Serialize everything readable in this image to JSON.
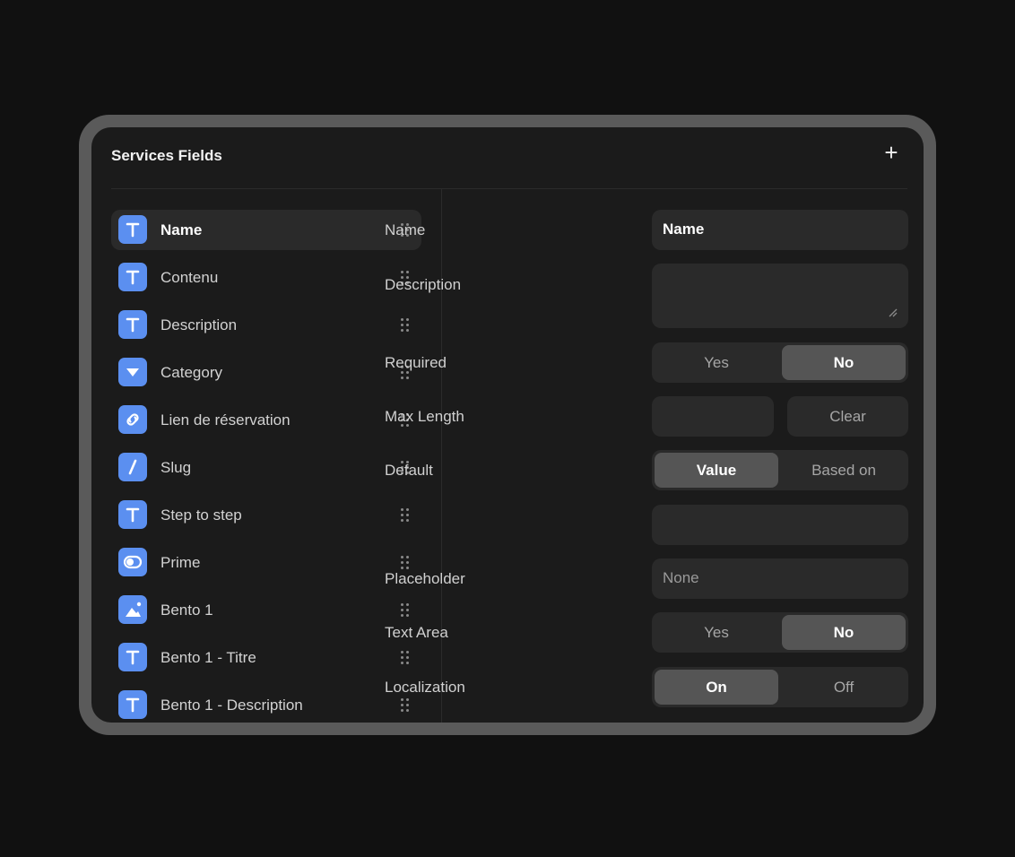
{
  "panel": {
    "title": "Services Fields",
    "add_label": "+"
  },
  "fields": [
    {
      "label": "Name",
      "icon": "text-icon",
      "selected": true
    },
    {
      "label": "Contenu",
      "icon": "text-icon"
    },
    {
      "label": "Description",
      "icon": "text-icon"
    },
    {
      "label": "Category",
      "icon": "dropdown-icon"
    },
    {
      "label": "Lien de réservation",
      "icon": "link-icon"
    },
    {
      "label": "Slug",
      "icon": "slash-icon"
    },
    {
      "label": "Step to step",
      "icon": "text-icon"
    },
    {
      "label": "Prime",
      "icon": "toggle-icon"
    },
    {
      "label": "Bento 1",
      "icon": "image-icon"
    },
    {
      "label": "Bento 1 - Titre",
      "icon": "text-icon"
    },
    {
      "label": "Bento 1 - Description",
      "icon": "text-icon"
    }
  ],
  "properties": {
    "name": {
      "label": "Name",
      "value": "Name"
    },
    "description": {
      "label": "Description",
      "value": ""
    },
    "required": {
      "label": "Required",
      "options": [
        "Yes",
        "No"
      ],
      "selected": "No"
    },
    "max_length": {
      "label": "Max Length",
      "value": "",
      "clear_label": "Clear"
    },
    "default": {
      "label": "Default",
      "options": [
        "Value",
        "Based on"
      ],
      "selected": "Value",
      "value": ""
    },
    "placeholder": {
      "label": "Placeholder",
      "value": "None"
    },
    "text_area": {
      "label": "Text Area",
      "options": [
        "Yes",
        "No"
      ],
      "selected": "No"
    },
    "localization": {
      "label": "Localization",
      "options": [
        "On",
        "Off"
      ],
      "selected": "On"
    }
  },
  "colors": {
    "background": "#111111",
    "panel": "#1b1b1b",
    "bezel": "#5a5a5a",
    "icon_accent": "#5b8ff0",
    "control": "#2a2a2a",
    "segment_active": "#555555"
  }
}
